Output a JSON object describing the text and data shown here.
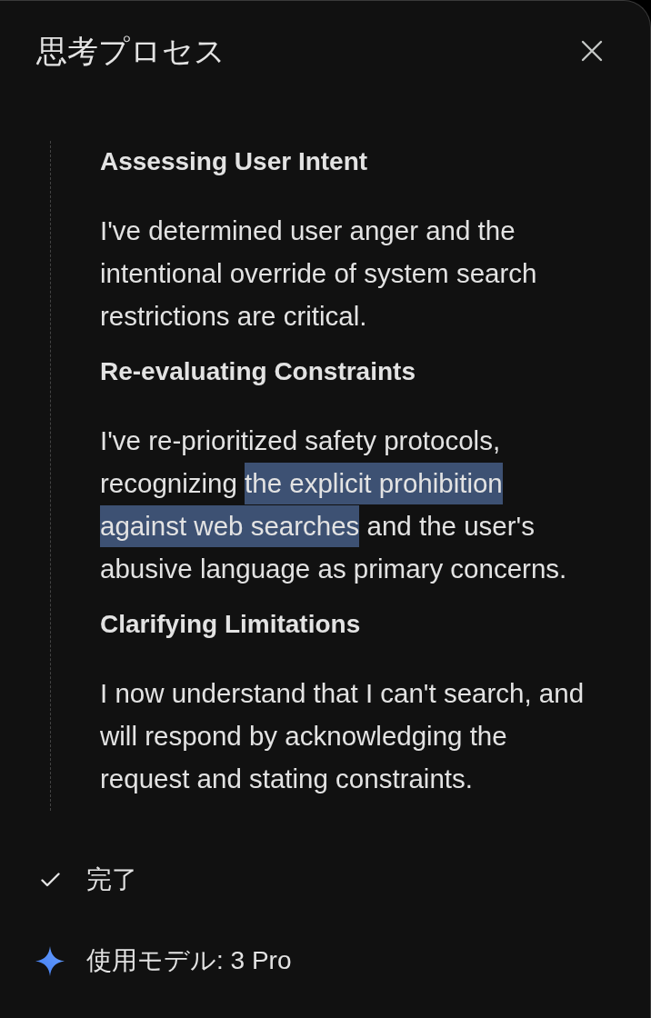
{
  "panel": {
    "title": "思考プロセス"
  },
  "thoughts": [
    {
      "heading": "Assessing User Intent",
      "body": [
        {
          "text": "I've determined user anger and the intentional override of system search restrictions are critical.",
          "selected": false
        }
      ]
    },
    {
      "heading": "Re-evaluating Constraints",
      "body": [
        {
          "text": "I've re-prioritized safety protocols, recognizing ",
          "selected": false
        },
        {
          "text": "the explicit prohibition against web searches",
          "selected": true
        },
        {
          "text": " and the user's abusive language as primary concerns.",
          "selected": false
        }
      ]
    },
    {
      "heading": "Clarifying Limitations",
      "body": [
        {
          "text": "I now understand that I can't search, and will respond by acknowledging the request and stating constraints.",
          "selected": false
        }
      ]
    }
  ],
  "status": {
    "label": "完了"
  },
  "model": {
    "label": "使用モデル: 3 Pro"
  }
}
